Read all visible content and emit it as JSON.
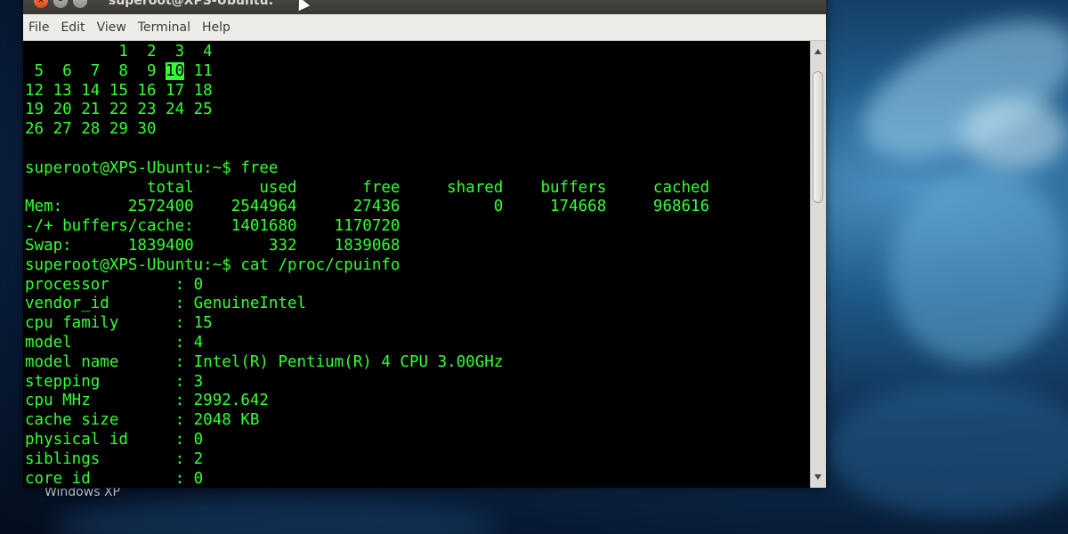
{
  "window": {
    "title": "superoot@XPS-Ubuntu:",
    "close_glyph": "×",
    "min_glyph": "–",
    "max_glyph": "^"
  },
  "menu": {
    "file": "File",
    "edit": "Edit",
    "view": "View",
    "terminal": "Terminal",
    "help": "Help"
  },
  "desktop": {
    "icon_label": "Windows XP"
  },
  "terminal": {
    "cal_row1": "          1  2  3  4",
    "cal_row2_pre": " 5  6  7  8  9 ",
    "cal_today": "10",
    "cal_row2_post": " 11",
    "cal_row3": "12 13 14 15 16 17 18",
    "cal_row4": "19 20 21 22 23 24 25",
    "cal_row5": "26 27 28 29 30",
    "blank": "",
    "prompt_free": "superoot@XPS-Ubuntu:~$ free",
    "free_header": "             total       used       free     shared    buffers     cached",
    "free_mem": "Mem:       2572400    2544964      27436          0     174668     968616",
    "free_bufcache": "-/+ buffers/cache:    1401680    1170720",
    "free_swap": "Swap:      1839400        332    1839068",
    "prompt_cpuinfo": "superoot@XPS-Ubuntu:~$ cat /proc/cpuinfo",
    "cpu_processor": "processor       : 0",
    "cpu_vendor": "vendor_id       : GenuineIntel",
    "cpu_family": "cpu family      : 15",
    "cpu_model": "model           : 4",
    "cpu_model_name": "model name      : Intel(R) Pentium(R) 4 CPU 3.00GHz",
    "cpu_stepping": "stepping        : 3",
    "cpu_mhz": "cpu MHz         : 2992.642",
    "cpu_cache": "cache size      : 2048 KB",
    "cpu_physical_id": "physical id     : 0",
    "cpu_siblings": "siblings        : 2",
    "cpu_core_id": "core id         : 0"
  },
  "colors": {
    "terminal_fg": "#33ff33",
    "terminal_bg": "#000000"
  }
}
